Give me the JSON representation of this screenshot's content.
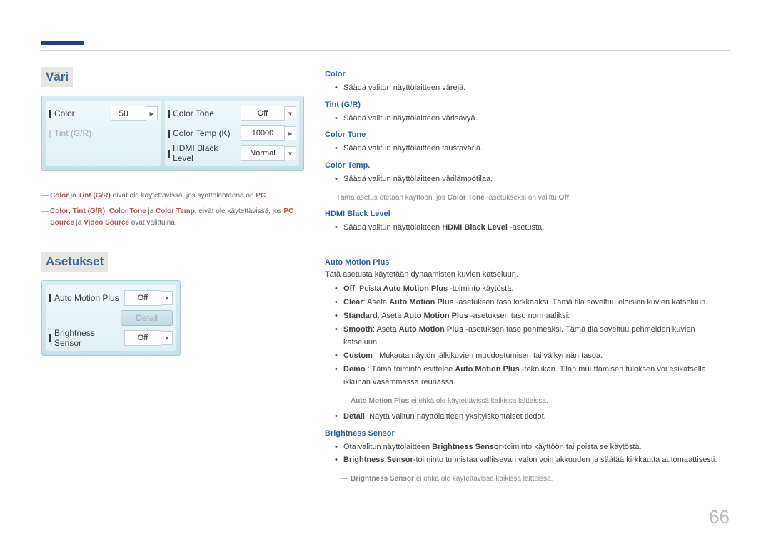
{
  "page_number": "66",
  "section1": {
    "title": "Väri",
    "controls": {
      "color_label": "Color",
      "color_value": "50",
      "tint_label": "Tint (G/R)",
      "tone_label": "Color Tone",
      "tone_value": "Off",
      "temp_label": "Color Temp (K)",
      "temp_value": "10000",
      "hdmi_label": "HDMI Black Level",
      "hdmi_value": "Normal"
    },
    "footnotes": {
      "n1_p1": "Color",
      "n1_p2": " ja ",
      "n1_p3": "Tint (G/R)",
      "n1_p4": " eivät ole käytettävissä, jos syöttölähteenä on ",
      "n1_p5": "PC",
      "n1_p6": ".",
      "n2_p1": "Color",
      "n2_p2": ", ",
      "n2_p3": "Tint (G/R)",
      "n2_p4": ", ",
      "n2_p5": "Color Tone",
      "n2_p6": " ja ",
      "n2_p7": "Color Temp.",
      "n2_p8": " eivät ole käytettävissä, jos ",
      "n2_p9": "PC Source",
      "n2_p10": " ja ",
      "n2_p11": "Video Source",
      "n2_p12": " ovat valittuina."
    }
  },
  "section2": {
    "title": "Asetukset",
    "controls": {
      "amp_label": "Auto Motion Plus",
      "amp_value": "Off",
      "detail_label": "Detail",
      "bright_label": "Brightness Sensor",
      "bright_value": "Off"
    }
  },
  "desc": {
    "color_h": "Color",
    "color_b": "Säädä valitun näyttölaitteen värejä.",
    "tint_h": "Tint (G/R)",
    "tint_b": "Säädä valitun näyttölaitteen värisävyä.",
    "tone_h": "Color Tone",
    "tone_b": "Säädä valitun näyttölaitteen taustaväriä.",
    "temp_h": "Color Temp.",
    "temp_b": "Säädä valitun näyttölaitteen värilämpötilaa.",
    "temp_note_1": "Tämä asetus otetaan käyttöön, jos ",
    "temp_note_2": "Color Tone",
    "temp_note_3": " -asetukseksi on valittu ",
    "temp_note_4": "Off",
    "temp_note_5": ".",
    "hdmi_h": "HDMI Black Level",
    "hdmi_b1": "Säädä valitun näyttölaitteen ",
    "hdmi_b2": "HDMI Black Level",
    "hdmi_b3": " -asetusta.",
    "amp_h": "Auto Motion Plus",
    "amp_intro": "Tätä asetusta käytetään dynaamisten kuvien katseluun.",
    "amp_off1": "Off",
    "amp_off2": ": Poista ",
    "amp_off3": "Auto Motion Plus",
    "amp_off4": " -toiminto käytöstä.",
    "amp_clear1": "Clear",
    "amp_clear2": ": Aseta ",
    "amp_clear3": "Auto Motion Plus",
    "amp_clear4": " -asetuksen taso kirkkaaksi. Tämä tila soveltuu eloisien kuvien katseluun.",
    "amp_std1": "Standard",
    "amp_std2": ": Aseta ",
    "amp_std3": "Auto Motion Plus",
    "amp_std4": " -asetuksen taso normaaliksi.",
    "amp_sm1": "Smooth",
    "amp_sm2": ": Aseta ",
    "amp_sm3": "Auto Motion Plus",
    "amp_sm4": " -asetuksen taso pehmeäksi. Tämä tila soveltuu pehmeiden kuvien katseluun.",
    "amp_cus1": "Custom",
    "amp_cus2": " : Mukauta näytön jälkikuvien muodostumisen tai välkynnän tasoa.",
    "amp_demo1": "Demo",
    "amp_demo2": " : Tämä toiminto esittelee ",
    "amp_demo3": "Auto Motion Plus",
    "amp_demo4": " -tekniikan. Tilan muuttamisen tuloksen voi esikatsella ikkunan vasemmassa reunassa.",
    "amp_note1": "Auto Motion Plus",
    "amp_note2": " ei ehkä ole käytettävissä kaikissa laitteissa.",
    "amp_det1": "Detail",
    "amp_det2": ": Näytä valitun näyttölaitteen yksityiskohtaiset tiedot.",
    "bs_h": "Brightness Sensor",
    "bs_b1a": "Ota valitun näyttölaitteen ",
    "bs_b1b": "Brightness Sensor",
    "bs_b1c": "-toiminto käyttöön tai poista se käytöstä.",
    "bs_b2a": "Brightness Sensor",
    "bs_b2b": "-toiminto tunnistaa vallitsevan valon voimakkuuden ja säätää kirkkautta automaattisesti.",
    "bs_note1": "Brightness Sensor",
    "bs_note2": " ei ehkä ole käytettävissä kaikissa laitteissa."
  }
}
